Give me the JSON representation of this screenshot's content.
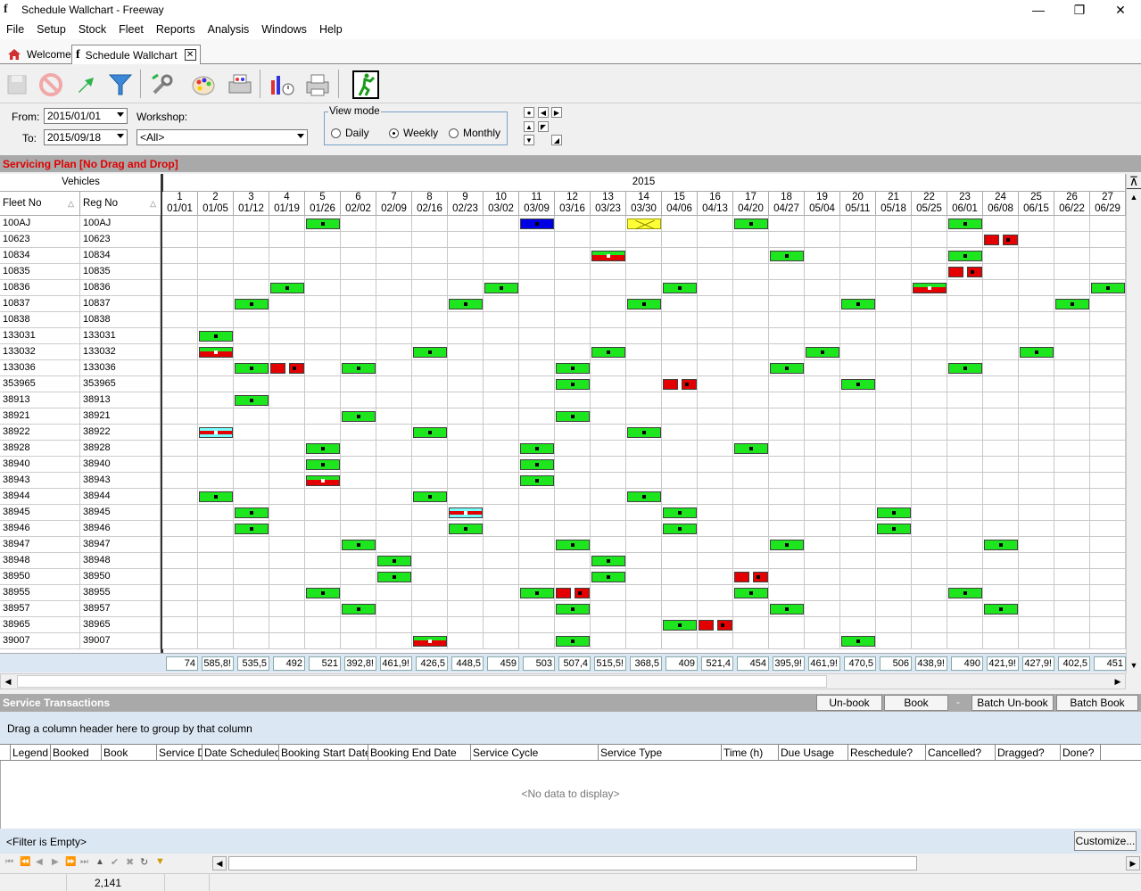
{
  "window": {
    "title": "Schedule Wallchart - Freeway",
    "minimize": "—",
    "restore": "❐",
    "close": "✕"
  },
  "menu": [
    "File",
    "Setup",
    "Stock",
    "Fleet",
    "Reports",
    "Analysis",
    "Windows",
    "Help"
  ],
  "tabs": [
    {
      "label": "Welcome"
    },
    {
      "label": "Schedule Wallchart"
    }
  ],
  "filters": {
    "from_label": "From:",
    "from_value": "2015/01/01",
    "to_label": "To:",
    "to_value": "2015/09/18",
    "workshop_label": "Workshop:",
    "workshop_value": "<All>"
  },
  "view_mode": {
    "legend": "View mode",
    "options": [
      "Daily",
      "Weekly",
      "Monthly"
    ],
    "selected": "Weekly"
  },
  "plan_header": "Servicing Plan [No Drag and Drop]",
  "grid": {
    "vehicles_header": "Vehicles",
    "year": "2015",
    "fleet_col": "Fleet No",
    "reg_col": "Reg No",
    "weeks": [
      {
        "n": "1",
        "d": "01/01"
      },
      {
        "n": "2",
        "d": "01/05"
      },
      {
        "n": "3",
        "d": "01/12"
      },
      {
        "n": "4",
        "d": "01/19"
      },
      {
        "n": "5",
        "d": "01/26"
      },
      {
        "n": "6",
        "d": "02/02"
      },
      {
        "n": "7",
        "d": "02/09"
      },
      {
        "n": "8",
        "d": "02/16"
      },
      {
        "n": "9",
        "d": "02/23"
      },
      {
        "n": "10",
        "d": "03/02"
      },
      {
        "n": "11",
        "d": "03/09"
      },
      {
        "n": "12",
        "d": "03/16"
      },
      {
        "n": "13",
        "d": "03/23"
      },
      {
        "n": "14",
        "d": "03/30"
      },
      {
        "n": "15",
        "d": "04/06"
      },
      {
        "n": "16",
        "d": "04/13"
      },
      {
        "n": "17",
        "d": "04/20"
      },
      {
        "n": "18",
        "d": "04/27"
      },
      {
        "n": "19",
        "d": "05/04"
      },
      {
        "n": "20",
        "d": "05/11"
      },
      {
        "n": "21",
        "d": "05/18"
      },
      {
        "n": "22",
        "d": "05/25"
      },
      {
        "n": "23",
        "d": "06/01"
      },
      {
        "n": "24",
        "d": "06/08"
      },
      {
        "n": "25",
        "d": "06/15"
      },
      {
        "n": "26",
        "d": "06/22"
      },
      {
        "n": "27",
        "d": "06/29"
      }
    ],
    "rows": [
      {
        "fleet": "100AJ",
        "reg": "100AJ"
      },
      {
        "fleet": "10623",
        "reg": "10623"
      },
      {
        "fleet": "10834",
        "reg": "10834"
      },
      {
        "fleet": "10835",
        "reg": "10835"
      },
      {
        "fleet": "10836",
        "reg": "10836"
      },
      {
        "fleet": "10837",
        "reg": "10837"
      },
      {
        "fleet": "10838",
        "reg": "10838"
      },
      {
        "fleet": "133031",
        "reg": "133031"
      },
      {
        "fleet": "133032",
        "reg": "133032"
      },
      {
        "fleet": "133036",
        "reg": "133036"
      },
      {
        "fleet": "353965",
        "reg": "353965"
      },
      {
        "fleet": "38913",
        "reg": "38913"
      },
      {
        "fleet": "38921",
        "reg": "38921"
      },
      {
        "fleet": "38922",
        "reg": "38922"
      },
      {
        "fleet": "38928",
        "reg": "38928"
      },
      {
        "fleet": "38940",
        "reg": "38940"
      },
      {
        "fleet": "38943",
        "reg": "38943"
      },
      {
        "fleet": "38944",
        "reg": "38944"
      },
      {
        "fleet": "38945",
        "reg": "38945"
      },
      {
        "fleet": "38946",
        "reg": "38946"
      },
      {
        "fleet": "38947",
        "reg": "38947"
      },
      {
        "fleet": "38948",
        "reg": "38948"
      },
      {
        "fleet": "38950",
        "reg": "38950"
      },
      {
        "fleet": "38955",
        "reg": "38955"
      },
      {
        "fleet": "38957",
        "reg": "38957"
      },
      {
        "fleet": "38965",
        "reg": "38965"
      },
      {
        "fleet": "39007",
        "reg": "39007"
      }
    ],
    "events": [
      {
        "row": 0,
        "week": 5,
        "type": "green"
      },
      {
        "row": 0,
        "week": 11,
        "type": "blue"
      },
      {
        "row": 0,
        "week": 14,
        "type": "yellow"
      },
      {
        "row": 0,
        "week": 17,
        "type": "green"
      },
      {
        "row": 0,
        "week": 23,
        "type": "green"
      },
      {
        "row": 1,
        "week": 24,
        "type": "split"
      },
      {
        "row": 2,
        "week": 13,
        "type": "redgreen"
      },
      {
        "row": 2,
        "week": 18,
        "type": "green"
      },
      {
        "row": 2,
        "week": 23,
        "type": "green"
      },
      {
        "row": 3,
        "week": 23,
        "type": "split"
      },
      {
        "row": 4,
        "week": 4,
        "type": "green"
      },
      {
        "row": 4,
        "week": 10,
        "type": "green"
      },
      {
        "row": 4,
        "week": 15,
        "type": "green"
      },
      {
        "row": 4,
        "week": 22,
        "type": "redgreen"
      },
      {
        "row": 4,
        "week": 27,
        "type": "green"
      },
      {
        "row": 5,
        "week": 3,
        "type": "green"
      },
      {
        "row": 5,
        "week": 9,
        "type": "green"
      },
      {
        "row": 5,
        "week": 14,
        "type": "green"
      },
      {
        "row": 5,
        "week": 20,
        "type": "green"
      },
      {
        "row": 5,
        "week": 26,
        "type": "green"
      },
      {
        "row": 7,
        "week": 2,
        "type": "green"
      },
      {
        "row": 8,
        "week": 2,
        "type": "redgreen"
      },
      {
        "row": 8,
        "week": 8,
        "type": "green"
      },
      {
        "row": 8,
        "week": 13,
        "type": "green"
      },
      {
        "row": 8,
        "week": 19,
        "type": "green"
      },
      {
        "row": 8,
        "week": 25,
        "type": "green"
      },
      {
        "row": 9,
        "week": 3,
        "type": "green"
      },
      {
        "row": 9,
        "week": 4,
        "type": "split"
      },
      {
        "row": 9,
        "week": 6,
        "type": "green"
      },
      {
        "row": 9,
        "week": 12,
        "type": "green"
      },
      {
        "row": 9,
        "week": 18,
        "type": "green"
      },
      {
        "row": 9,
        "week": 23,
        "type": "green"
      },
      {
        "row": 10,
        "week": 12,
        "type": "green"
      },
      {
        "row": 10,
        "week": 15,
        "type": "split"
      },
      {
        "row": 10,
        "week": 20,
        "type": "green"
      },
      {
        "row": 11,
        "week": 3,
        "type": "green"
      },
      {
        "row": 12,
        "week": 6,
        "type": "green"
      },
      {
        "row": 12,
        "week": 12,
        "type": "green"
      },
      {
        "row": 13,
        "week": 2,
        "type": "redcyan"
      },
      {
        "row": 13,
        "week": 8,
        "type": "green"
      },
      {
        "row": 13,
        "week": 14,
        "type": "green"
      },
      {
        "row": 14,
        "week": 5,
        "type": "green"
      },
      {
        "row": 14,
        "week": 11,
        "type": "green"
      },
      {
        "row": 14,
        "week": 17,
        "type": "green"
      },
      {
        "row": 15,
        "week": 5,
        "type": "green"
      },
      {
        "row": 15,
        "week": 11,
        "type": "green"
      },
      {
        "row": 16,
        "week": 5,
        "type": "redgreen"
      },
      {
        "row": 16,
        "week": 11,
        "type": "green"
      },
      {
        "row": 17,
        "week": 2,
        "type": "green"
      },
      {
        "row": 17,
        "week": 8,
        "type": "green"
      },
      {
        "row": 17,
        "week": 14,
        "type": "green"
      },
      {
        "row": 18,
        "week": 3,
        "type": "green"
      },
      {
        "row": 18,
        "week": 9,
        "type": "redcyan"
      },
      {
        "row": 18,
        "week": 15,
        "type": "green"
      },
      {
        "row": 18,
        "week": 21,
        "type": "green"
      },
      {
        "row": 19,
        "week": 3,
        "type": "green"
      },
      {
        "row": 19,
        "week": 9,
        "type": "green"
      },
      {
        "row": 19,
        "week": 15,
        "type": "green"
      },
      {
        "row": 19,
        "week": 21,
        "type": "green"
      },
      {
        "row": 20,
        "week": 6,
        "type": "green"
      },
      {
        "row": 20,
        "week": 12,
        "type": "green"
      },
      {
        "row": 20,
        "week": 18,
        "type": "green"
      },
      {
        "row": 20,
        "week": 24,
        "type": "green"
      },
      {
        "row": 21,
        "week": 7,
        "type": "green"
      },
      {
        "row": 21,
        "week": 13,
        "type": "green"
      },
      {
        "row": 22,
        "week": 7,
        "type": "green"
      },
      {
        "row": 22,
        "week": 13,
        "type": "green"
      },
      {
        "row": 22,
        "week": 17,
        "type": "split"
      },
      {
        "row": 23,
        "week": 5,
        "type": "green"
      },
      {
        "row": 23,
        "week": 11,
        "type": "green"
      },
      {
        "row": 23,
        "week": 12,
        "type": "split"
      },
      {
        "row": 23,
        "week": 17,
        "type": "green"
      },
      {
        "row": 23,
        "week": 23,
        "type": "green"
      },
      {
        "row": 24,
        "week": 6,
        "type": "green"
      },
      {
        "row": 24,
        "week": 12,
        "type": "green"
      },
      {
        "row": 24,
        "week": 18,
        "type": "green"
      },
      {
        "row": 24,
        "week": 24,
        "type": "green"
      },
      {
        "row": 25,
        "week": 15,
        "type": "green"
      },
      {
        "row": 25,
        "week": 16,
        "type": "split"
      },
      {
        "row": 26,
        "week": 8,
        "type": "redgreen"
      },
      {
        "row": 26,
        "week": 12,
        "type": "green"
      },
      {
        "row": 26,
        "week": 20,
        "type": "green"
      }
    ],
    "totals": [
      "74",
      "585,8!",
      "535,5",
      "492",
      "521",
      "392,8!",
      "461,9!",
      "426,5",
      "448,5",
      "459",
      "503",
      "507,4",
      "515,5!",
      "368,5",
      "409",
      "521,4",
      "454",
      "395,9!",
      "461,9!",
      "470,5",
      "506",
      "438,9!",
      "490",
      "421,9!",
      "427,9!",
      "402,5",
      "451"
    ]
  },
  "service": {
    "header": "Service Transactions",
    "buttons": [
      "Un-book",
      "Book",
      "-",
      "Batch Un-book",
      "Batch Book"
    ],
    "group_hint": "Drag a column header here to group by that column",
    "columns": [
      "Legend",
      "Booked",
      "Book",
      "Service Date",
      "Date Scheduled",
      "Booking Start Date",
      "Booking End Date",
      "Service Cycle",
      "Service Type",
      "Time (h)",
      "Due Usage",
      "Reschedule?",
      "Cancelled?",
      "Dragged?",
      "Done?"
    ],
    "no_data": "<No data to display>",
    "filter_text": "<Filter is Empty>",
    "customize": "Customize..."
  },
  "status": {
    "count": "2,141"
  },
  "colors": {
    "green": "#1ee61e",
    "red": "#e40000",
    "blue": "#0000e6",
    "yellow": "#ffff38",
    "header_gray": "#a9a9a9",
    "plan_title_red": "#e00000"
  }
}
